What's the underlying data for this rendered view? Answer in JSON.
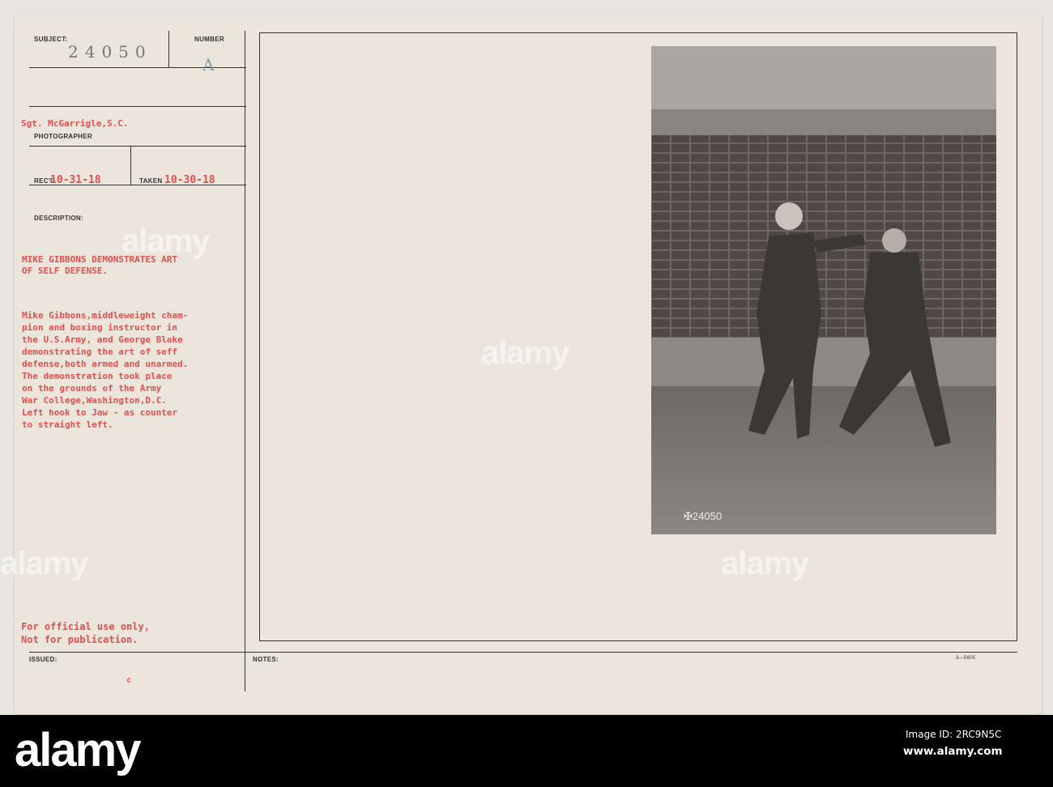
{
  "form": {
    "subject_label": "SUBJECT:",
    "subject_number": "24050",
    "number_label": "NUMBER",
    "number_value": "A",
    "photographer": "Sgt. McGarrigle,S.C.",
    "photographer_label": "PHOTOGRAPHER",
    "recd_label": "REC'D",
    "recd_date": "10-31-18",
    "taken_label": "TAKEN",
    "taken_date": "10-30-18",
    "description_label": "DESCRIPTION:",
    "title": "MIKE GIBBONS DEMONSTRATES ART\nOF SELF DEFENSE.",
    "body": "Mike Gibbons,middleweight cham-\npion and boxing instructor in\nthe U.S.Army, and George Blake\ndemonstrating the art of seff\ndefense,both armed and unarmed.\nThe demonstration took place\non the grounds of the Army\nWar College,Washington,D.C.\nLeft hook to Jaw - as counter\nto straight left.",
    "official": "For official use only,\nNot for publication.",
    "issued_label": "ISSUED:",
    "issued_mark": "c",
    "notes_label": "NOTES:",
    "form_code": "3—5605",
    "photo_number": "24050"
  },
  "watermark": {
    "text": "alamy",
    "logo": "alamy",
    "image_id": "Image ID: 2RC9N5C",
    "site": "www.alamy.com"
  }
}
